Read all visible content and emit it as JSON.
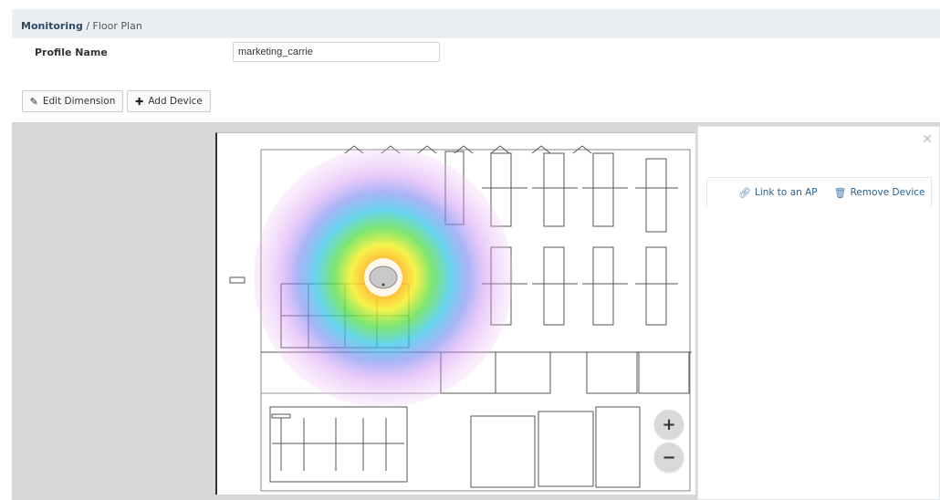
{
  "breadcrumb": {
    "root": "Monitoring",
    "separator": "/",
    "current": "Floor Plan"
  },
  "profile": {
    "label": "Profile Name",
    "value": "marketing_carrie"
  },
  "toolbar": {
    "edit_icon": "pencil-icon",
    "edit_label": "Edit Dimension",
    "add_icon": "plus-icon",
    "add_label": "Add Device"
  },
  "zoom": {
    "in_label": "+",
    "out_label": "−"
  },
  "panel": {
    "close_label": "✕",
    "link_icon": "link-icon",
    "link_label": "Link to an AP",
    "remove_icon": "trash-icon",
    "remove_label": "Remove Device"
  },
  "colors": {
    "accent": "#2a5f8f",
    "breadcrumb_bg": "#ebeff2",
    "workspace_bg": "#d7d8da"
  }
}
